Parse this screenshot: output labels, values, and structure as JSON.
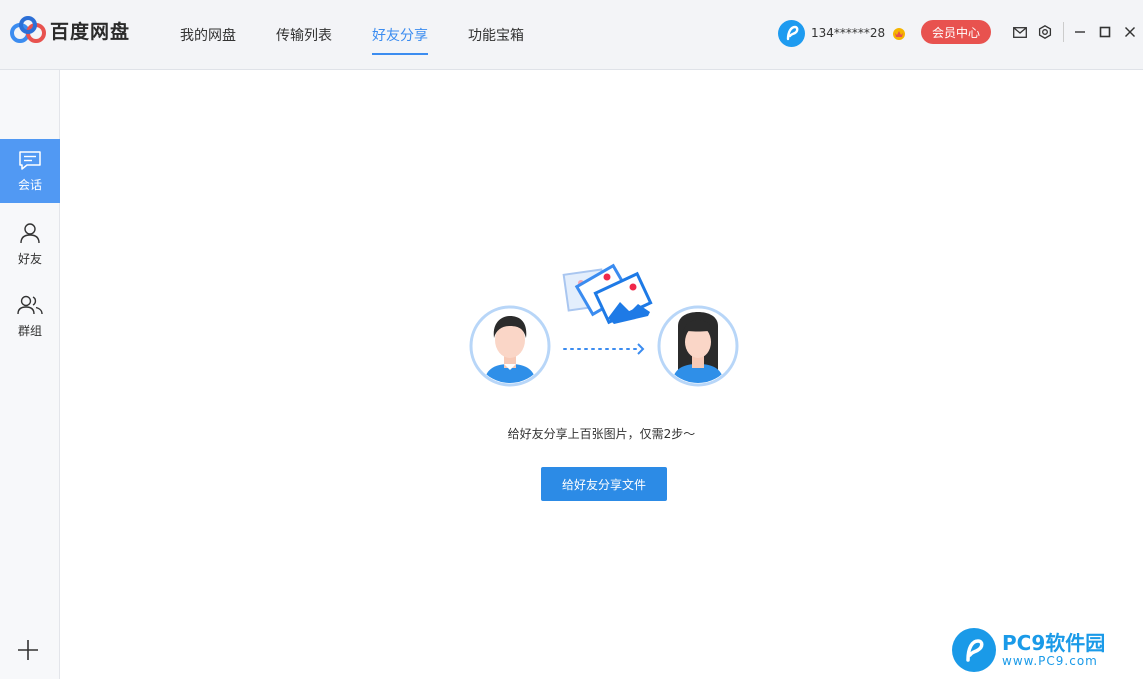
{
  "app": {
    "title": "百度网盘"
  },
  "nav": {
    "tabs": [
      {
        "label": "我的网盘",
        "active": false
      },
      {
        "label": "传输列表",
        "active": false
      },
      {
        "label": "好友分享",
        "active": true
      },
      {
        "label": "功能宝箱",
        "active": false
      }
    ]
  },
  "user": {
    "name": "134******28",
    "member_label": "会员中心"
  },
  "sidebar": {
    "items": [
      {
        "label": "会话",
        "icon": "chat-icon",
        "active": true
      },
      {
        "label": "好友",
        "icon": "person-icon",
        "active": false
      },
      {
        "label": "群组",
        "icon": "group-icon",
        "active": false
      }
    ]
  },
  "main": {
    "hint": "给好友分享上百张图片，仅需2步～",
    "share_button": "给好友分享文件"
  },
  "watermark": {
    "title": "PC9软件园",
    "url": "www.PC9.com"
  },
  "colors": {
    "accent": "#3b8cf0",
    "member": "#e8524f",
    "button": "#2c8be6",
    "sidebar_active": "#5199f3"
  }
}
